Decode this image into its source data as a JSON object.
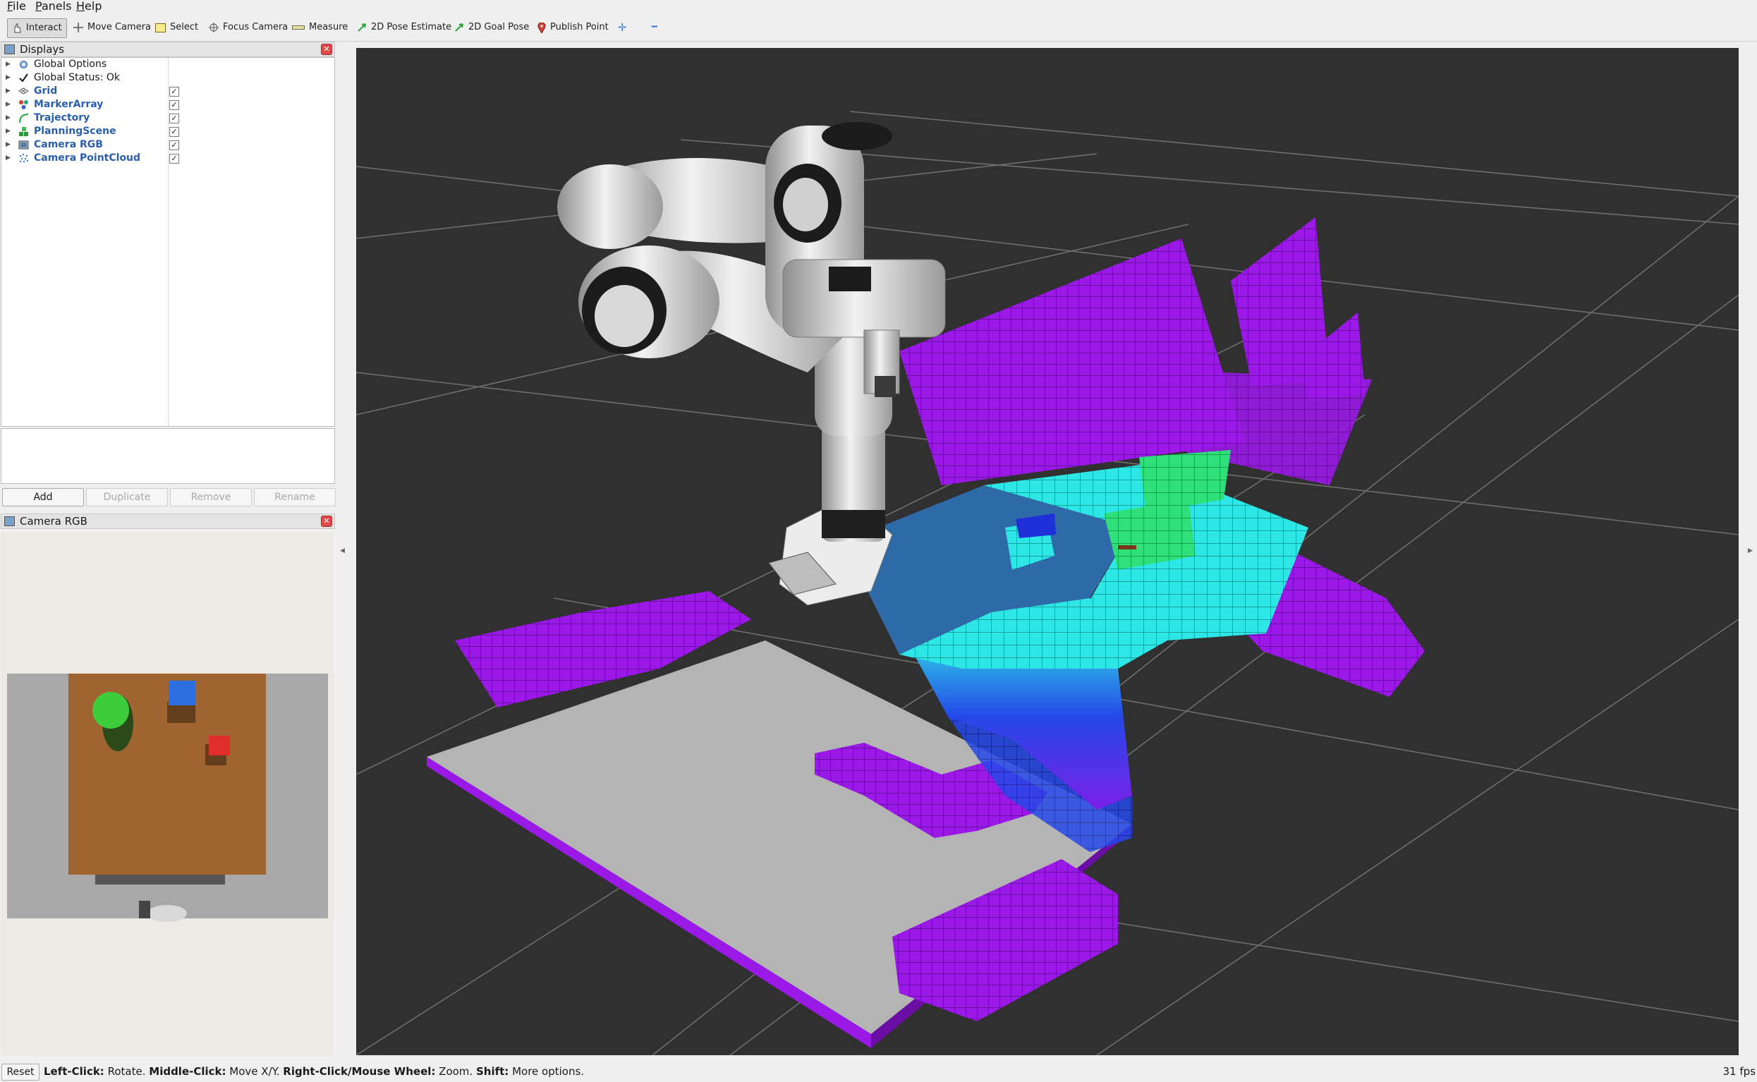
{
  "menu": [
    {
      "first": "F",
      "rest": "ile"
    },
    {
      "first": "P",
      "rest": "anels"
    },
    {
      "first": "H",
      "rest": "elp"
    }
  ],
  "toolbar": {
    "interact": "Interact",
    "move_camera": "Move Camera",
    "select": "Select",
    "focus_camera": "Focus Camera",
    "measure": "Measure",
    "pose_estimate": "2D Pose Estimate",
    "goal_pose": "2D Goal Pose",
    "publish_point": "Publish Point",
    "plus": "✛",
    "minus": "━"
  },
  "displays_panel": {
    "title": "Displays",
    "items": [
      {
        "label": "Global Options",
        "icon": "gear-icon",
        "checkbox": false
      },
      {
        "label": "Global Status: Ok",
        "icon": "checkmark-icon",
        "checkbox": false
      },
      {
        "label": "Grid",
        "icon": "grid-icon",
        "checkbox": true,
        "checked": "✓"
      },
      {
        "label": "MarkerArray",
        "icon": "marker-array-icon",
        "checkbox": true,
        "checked": "✓"
      },
      {
        "label": "Trajectory",
        "icon": "trajectory-icon",
        "checkbox": true,
        "checked": "✓"
      },
      {
        "label": "PlanningScene",
        "icon": "planning-scene-icon",
        "checkbox": true,
        "checked": "✓"
      },
      {
        "label": "Camera RGB",
        "icon": "camera-icon",
        "checkbox": true,
        "checked": "✓"
      },
      {
        "label": "Camera PointCloud",
        "icon": "pointcloud-icon",
        "checkbox": true,
        "checked": "✓"
      }
    ],
    "buttons": {
      "add": "Add",
      "duplicate": "Duplicate",
      "remove": "Remove",
      "rename": "Rename"
    }
  },
  "camera_panel": {
    "title": "Camera RGB"
  },
  "status": {
    "reset": "Reset",
    "hint_left_click": "Left-Click:",
    "hint_rotate": "Rotate.",
    "hint_middle_click": "Middle-Click:",
    "hint_move": "Move X/Y.",
    "hint_right_click": "Right-Click/Mouse Wheel:",
    "hint_zoom": "Zoom.",
    "hint_shift": "Shift:",
    "hint_more": "More options.",
    "fps": "31 fps"
  },
  "colors": {
    "viewport_bg": "#303030",
    "grid": "#6e6e6e",
    "octomap_purple": "#9a19e6",
    "octomap_blue": "#2030e0",
    "octomap_cyan": "#2ee6e6",
    "octomap_green": "#2fe07a",
    "table_top": "#2f6aa8",
    "table_gray": "#b4b4b4"
  }
}
